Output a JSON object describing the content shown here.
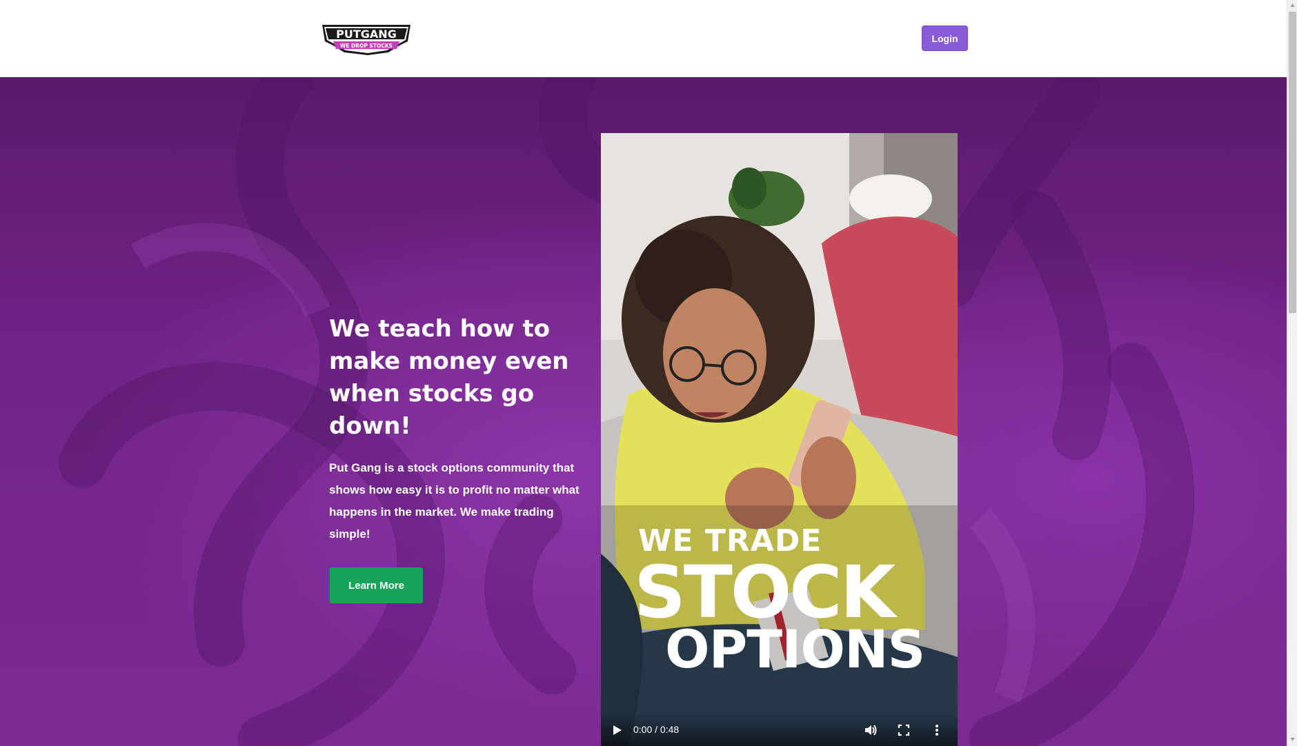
{
  "header": {
    "logo": {
      "wordmark": "PUTGANG",
      "tagline": "WE DROP STOCKS",
      "icon": "putgang-logo"
    },
    "login_label": "Login"
  },
  "hero": {
    "headline": "We teach how to make money even when stocks go down!",
    "description": "Put Gang is a stock options community that shows how easy it is to profit no matter what happens in the market. We make trading simple!",
    "cta_label": "Learn More",
    "colors": {
      "background": "#7b2a92",
      "cta": "#17a35a",
      "login": "#8a5bd8"
    }
  },
  "video": {
    "overlay_line1": "WE TRADE",
    "overlay_line2": "STOCK",
    "overlay_line3": "OPTIONS",
    "current_time": "0:00 / 0:48",
    "controls": [
      "play-icon",
      "volume-icon",
      "fullscreen-icon",
      "more-options-icon"
    ]
  }
}
